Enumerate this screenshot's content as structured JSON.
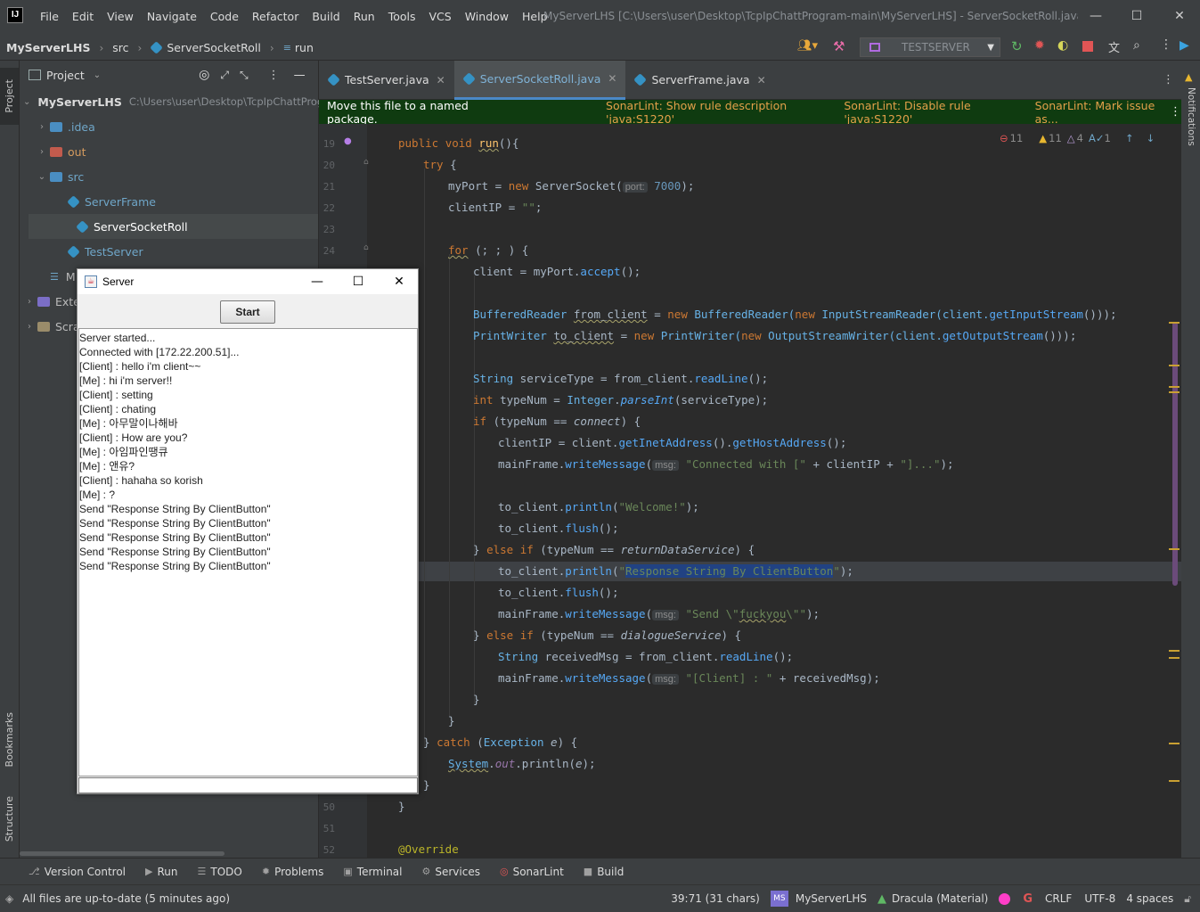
{
  "window": {
    "title": "MyServerLHS [C:\\Users\\user\\Desktop\\TcpIpChattProgram-main\\MyServerLHS] - ServerSocketRoll.java"
  },
  "menu": [
    "File",
    "Edit",
    "View",
    "Navigate",
    "Code",
    "Refactor",
    "Build",
    "Run",
    "Tools",
    "VCS",
    "Window",
    "Help"
  ],
  "breadcrumb": {
    "project": "MyServerLHS",
    "folder": "src",
    "file": "ServerSocketRoll",
    "method": "run"
  },
  "run_config": "TESTSERVER",
  "project_panel": {
    "title": "Project",
    "root_name": "MyServerLHS",
    "root_path": "C:\\Users\\user\\Desktop\\TcpIpChattProgram-main\\MyServerLHS",
    "idea": ".idea",
    "out": "out",
    "src": "src",
    "files": [
      "ServerFrame",
      "ServerSocketRoll",
      "TestServer"
    ],
    "m_stub": "M",
    "external": "Exter",
    "scratches": "Scrat"
  },
  "tabs": [
    "TestServer.java",
    "ServerSocketRoll.java",
    "ServerFrame.java"
  ],
  "banner": {
    "message": "Move this file to a named package.",
    "links": [
      "SonarLint: Show rule description 'java:S1220'",
      "SonarLint: Disable rule 'java:S1220'",
      "SonarLint: Mark issue as..."
    ]
  },
  "inspections": {
    "errors": "11",
    "warnings": "11",
    "weak_warnings": "4",
    "typos": "1"
  },
  "line_numbers": [
    "19",
    "20",
    "21",
    "22",
    "23",
    "24",
    "50",
    "51",
    "52"
  ],
  "code": {
    "l19": [
      "public",
      "void",
      "run",
      "(){"
    ],
    "l20": [
      "try",
      "{"
    ],
    "l21": [
      "myPort = ",
      "new",
      "ServerSocket(",
      "port:",
      "7000",
      ");"
    ],
    "l22": [
      "clientIP = ",
      "\"\"",
      ";"
    ],
    "l24": [
      "for",
      "(; ; ) {"
    ],
    "l25": [
      "client = myPort.",
      "accept",
      "();"
    ],
    "l27": [
      "BufferedReader",
      "from_client",
      " = ",
      "new",
      "BufferedReader(",
      "new",
      "InputStreamReader(client.",
      "getInputStream",
      "()));"
    ],
    "l28": [
      "PrintWriter",
      "to_client",
      " = ",
      "new",
      "PrintWriter(",
      "new",
      "OutputStreamWriter(client.",
      "getOutputStream",
      "()));"
    ],
    "l30": [
      "String",
      " serviceType = from_client.",
      "readLine",
      "();"
    ],
    "l31": [
      "int",
      " typeNum = ",
      "Integer",
      ".",
      "parseInt",
      "(serviceType);"
    ],
    "l32": [
      "if",
      " (typeNum == ",
      "connect",
      ") {"
    ],
    "l33": [
      "clientIP = client.",
      "getInetAddress",
      "().",
      "getHostAddress",
      "();"
    ],
    "l34": [
      "mainFrame.",
      "writeMessage",
      "(",
      "msg:",
      "\"Connected with [\"",
      " + clientIP + ",
      "\"]...\"",
      ");"
    ],
    "l36": [
      "to_client.",
      "println",
      "(",
      "\"Welcome!\"",
      ");"
    ],
    "l37": [
      "to_client.",
      "flush",
      "();"
    ],
    "l38": [
      "} ",
      "else if",
      " (typeNum == ",
      "returnDataService",
      ") {"
    ],
    "l39": [
      "to_client.",
      "println",
      "(",
      "\"",
      "Response String By ClientButton",
      "\"",
      ");"
    ],
    "l40": [
      "to_client.",
      "flush",
      "();"
    ],
    "l41": [
      "mainFrame.",
      "writeMessage",
      "(",
      "msg:",
      "\"Send \\\"",
      "fuckyou",
      "\\\"\"",
      ");"
    ],
    "l42": [
      "} ",
      "else if",
      " (typeNum == ",
      "dialogueService",
      ") {"
    ],
    "l43": [
      "String",
      " receivedMsg = from_client.",
      "readLine",
      "();"
    ],
    "l44": [
      "mainFrame.",
      "writeMessage",
      "(",
      "msg:",
      "\"[Client] : \"",
      " + receivedMsg);"
    ],
    "l45": "}",
    "l46": "}",
    "l47": [
      "} ",
      "catch",
      " (",
      "Exception",
      " ",
      "e",
      ") {"
    ],
    "l48": [
      "System",
      ".",
      "out",
      ".println(",
      "e",
      ");"
    ],
    "l49": "}",
    "l50": "}",
    "l52": "@Override"
  },
  "swing": {
    "title": "Server",
    "start_label": "Start",
    "log": [
      "Server started...",
      "Connected with [172.22.200.51]...",
      "[Client] : hello i'm client~~",
      "[Me] : hi i'm server!!",
      "[Client] : setting",
      "[Client] : chating",
      "[Me] : 아무말이나해바",
      "[Client] : How are you?",
      "[Me] : 아임파인땡큐",
      "[Me] : 앤유?",
      "[Client] : hahaha so korish",
      "[Me] : ?",
      "Send \"Response String By ClientButton\"",
      "Send \"Response String By ClientButton\"",
      "Send \"Response String By ClientButton\"",
      "Send \"Response String By ClientButton\"",
      "Send \"Response String By ClientButton\""
    ]
  },
  "side_labels": {
    "project": "Project",
    "bookmarks": "Bookmarks",
    "structure": "Structure",
    "notifications": "Notifications"
  },
  "tool_windows": [
    "Version Control",
    "Run",
    "TODO",
    "Problems",
    "Terminal",
    "Services",
    "SonarLint",
    "Build"
  ],
  "status": {
    "message": "All files are up-to-date (5 minutes ago)",
    "position": "39:71 (31 chars)",
    "project_badge": "MS",
    "project": "MyServerLHS",
    "theme": "Dracula (Material)",
    "line_sep": "CRLF",
    "encoding": "UTF-8",
    "indent": "4 spaces"
  },
  "colors": {
    "accent": "#4a88c7",
    "banner_bg": "#0f3b10",
    "banner_link": "#e3a04a",
    "keyword": "#cc7832",
    "string": "#6a8759"
  }
}
